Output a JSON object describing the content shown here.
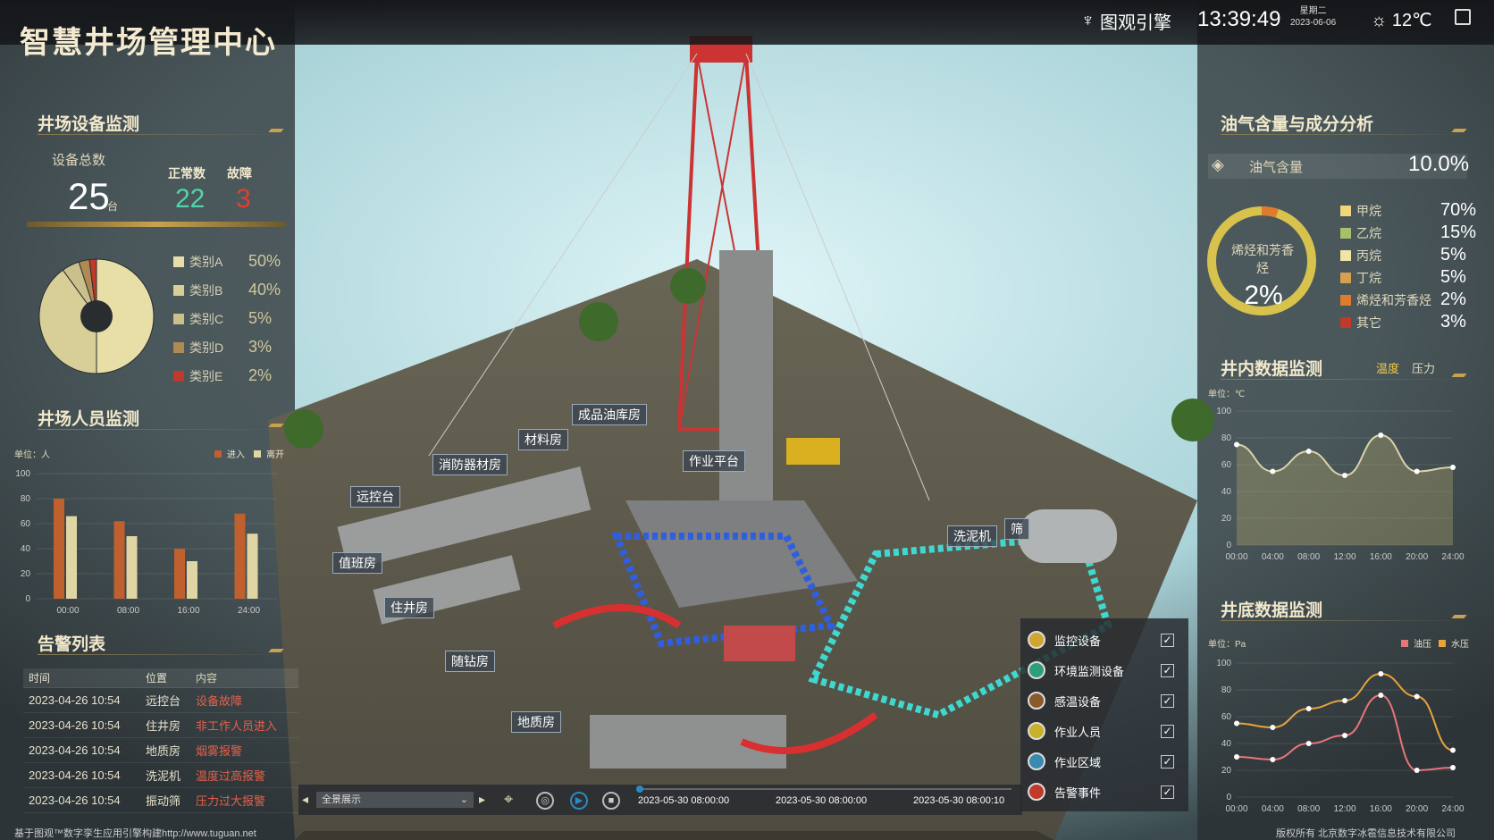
{
  "header": {
    "title": "智慧井场管理中心",
    "brand": "图观引擎",
    "time": "13:39:49",
    "weekday": "星期二",
    "date": "2023-06-06",
    "weather": "12℃"
  },
  "equipment": {
    "title": "井场设备监测",
    "total_label": "设备总数",
    "total": "25",
    "unit": "台",
    "normal_label": "正常数",
    "normal": "22",
    "fault_label": "故障",
    "fault": "3",
    "categories": [
      {
        "name": "类别A",
        "pct": "50%",
        "value": 50,
        "color": "#e8dfa8"
      },
      {
        "name": "类别B",
        "pct": "40%",
        "value": 40,
        "color": "#d8cf98"
      },
      {
        "name": "类别C",
        "pct": "5%",
        "value": 5,
        "color": "#c9c08c"
      },
      {
        "name": "类别D",
        "pct": "3%",
        "value": 3,
        "color": "#b08a52"
      },
      {
        "name": "类别E",
        "pct": "2%",
        "value": 2,
        "color": "#c0392b"
      }
    ]
  },
  "personnel": {
    "title": "井场人员监测",
    "unit_label": "单位：人",
    "legend_in": "进入",
    "legend_out": "离开",
    "chart_data": {
      "type": "bar",
      "categories": [
        "00:00",
        "08:00",
        "16:00",
        "24:00"
      ],
      "series": [
        {
          "name": "进入",
          "values": [
            80,
            62,
            40,
            68
          ],
          "color": "#c0602e"
        },
        {
          "name": "离开",
          "values": [
            66,
            50,
            30,
            52
          ],
          "color": "#e0d6a4"
        }
      ],
      "ylim": [
        0,
        100
      ],
      "yticks": [
        0,
        20,
        40,
        60,
        80,
        100
      ]
    }
  },
  "alarms": {
    "title": "告警列表",
    "headers": [
      "时间",
      "位置",
      "内容"
    ],
    "rows": [
      [
        "2023-04-26 10:54",
        "远控台",
        "设备故障"
      ],
      [
        "2023-04-26 10:54",
        "住井房",
        "非工作人员进入"
      ],
      [
        "2023-04-26 10:54",
        "地质房",
        "烟雾报警"
      ],
      [
        "2023-04-26 10:54",
        "洗泥机",
        "温度过高报警"
      ],
      [
        "2023-04-26 10:54",
        "振动筛",
        "压力过大报警"
      ]
    ]
  },
  "oilgas": {
    "title": "油气含量与成分分析",
    "content_label": "油气含量",
    "content_value": "10.0%",
    "ring_label": "烯烃和芳香烃",
    "ring_value": "2%",
    "ring_fraction": 0.02,
    "components": [
      {
        "name": "甲烷",
        "pct": "70%",
        "color": "#f1d57a"
      },
      {
        "name": "乙烷",
        "pct": "15%",
        "color": "#a9c06a"
      },
      {
        "name": "丙烷",
        "pct": "5%",
        "color": "#f2e4a6"
      },
      {
        "name": "丁烷",
        "pct": "5%",
        "color": "#d8a04e"
      },
      {
        "name": "烯烃和芳香烃",
        "pct": "2%",
        "color": "#e07b2e"
      },
      {
        "name": "其它",
        "pct": "3%",
        "color": "#c0392b"
      }
    ]
  },
  "well_inner": {
    "title": "井内数据监测",
    "tab1": "温度",
    "tab2": "压力",
    "unit": "单位：℃",
    "chart_data": {
      "type": "line",
      "x": [
        "00:00",
        "04:00",
        "08:00",
        "12:00",
        "16:00",
        "20:00",
        "24:00"
      ],
      "series": [
        {
          "name": "温度",
          "values": [
            75,
            55,
            70,
            52,
            82,
            55,
            58
          ]
        }
      ],
      "ylim": [
        0,
        100
      ],
      "yticks": [
        0,
        20,
        40,
        60,
        80,
        100
      ]
    }
  },
  "well_bottom": {
    "title": "井底数据监测",
    "unit": "单位：Pa",
    "legend1": "油压",
    "legend2": "水压",
    "chart_data": {
      "type": "line",
      "x": [
        "00:00",
        "04:00",
        "08:00",
        "12:00",
        "16:00",
        "20:00",
        "24:00"
      ],
      "series": [
        {
          "name": "油压",
          "values": [
            30,
            28,
            40,
            46,
            76,
            20,
            22
          ],
          "color": "#e8757a"
        },
        {
          "name": "水压",
          "values": [
            55,
            52,
            66,
            72,
            92,
            75,
            35
          ],
          "color": "#e6a33c"
        }
      ],
      "ylim": [
        0,
        100
      ],
      "yticks": [
        0,
        20,
        40,
        60,
        80,
        100
      ]
    }
  },
  "layers": [
    {
      "name": "监控设备",
      "color": "#d1a530"
    },
    {
      "name": "环境监测设备",
      "color": "#2e9e7a"
    },
    {
      "name": "感温设备",
      "color": "#8a5a2a"
    },
    {
      "name": "作业人员",
      "color": "#c8b028"
    },
    {
      "name": "作业区域",
      "color": "#3a8ab0"
    },
    {
      "name": "告警事件",
      "color": "#c0392b"
    }
  ],
  "map_labels": [
    {
      "text": "成品油库房"
    },
    {
      "text": "材料房"
    },
    {
      "text": "消防器材房"
    },
    {
      "text": "远控台"
    },
    {
      "text": "作业平台"
    },
    {
      "text": "值班房"
    },
    {
      "text": "住井房"
    },
    {
      "text": "随钻房"
    },
    {
      "text": "地质房"
    },
    {
      "text": "洗泥机"
    },
    {
      "text": "筛"
    }
  ],
  "timeline": {
    "select": "全景展示",
    "t1": "2023-05-30 08:00:00",
    "t2": "2023-05-30 08:00:00",
    "t3": "2023-05-30 08:00:10"
  },
  "footer": {
    "left": "基于图观™数字孪生应用引擎构建http://www.tuguan.net",
    "right": "版权所有 北京数字冰雹信息技术有限公司"
  }
}
